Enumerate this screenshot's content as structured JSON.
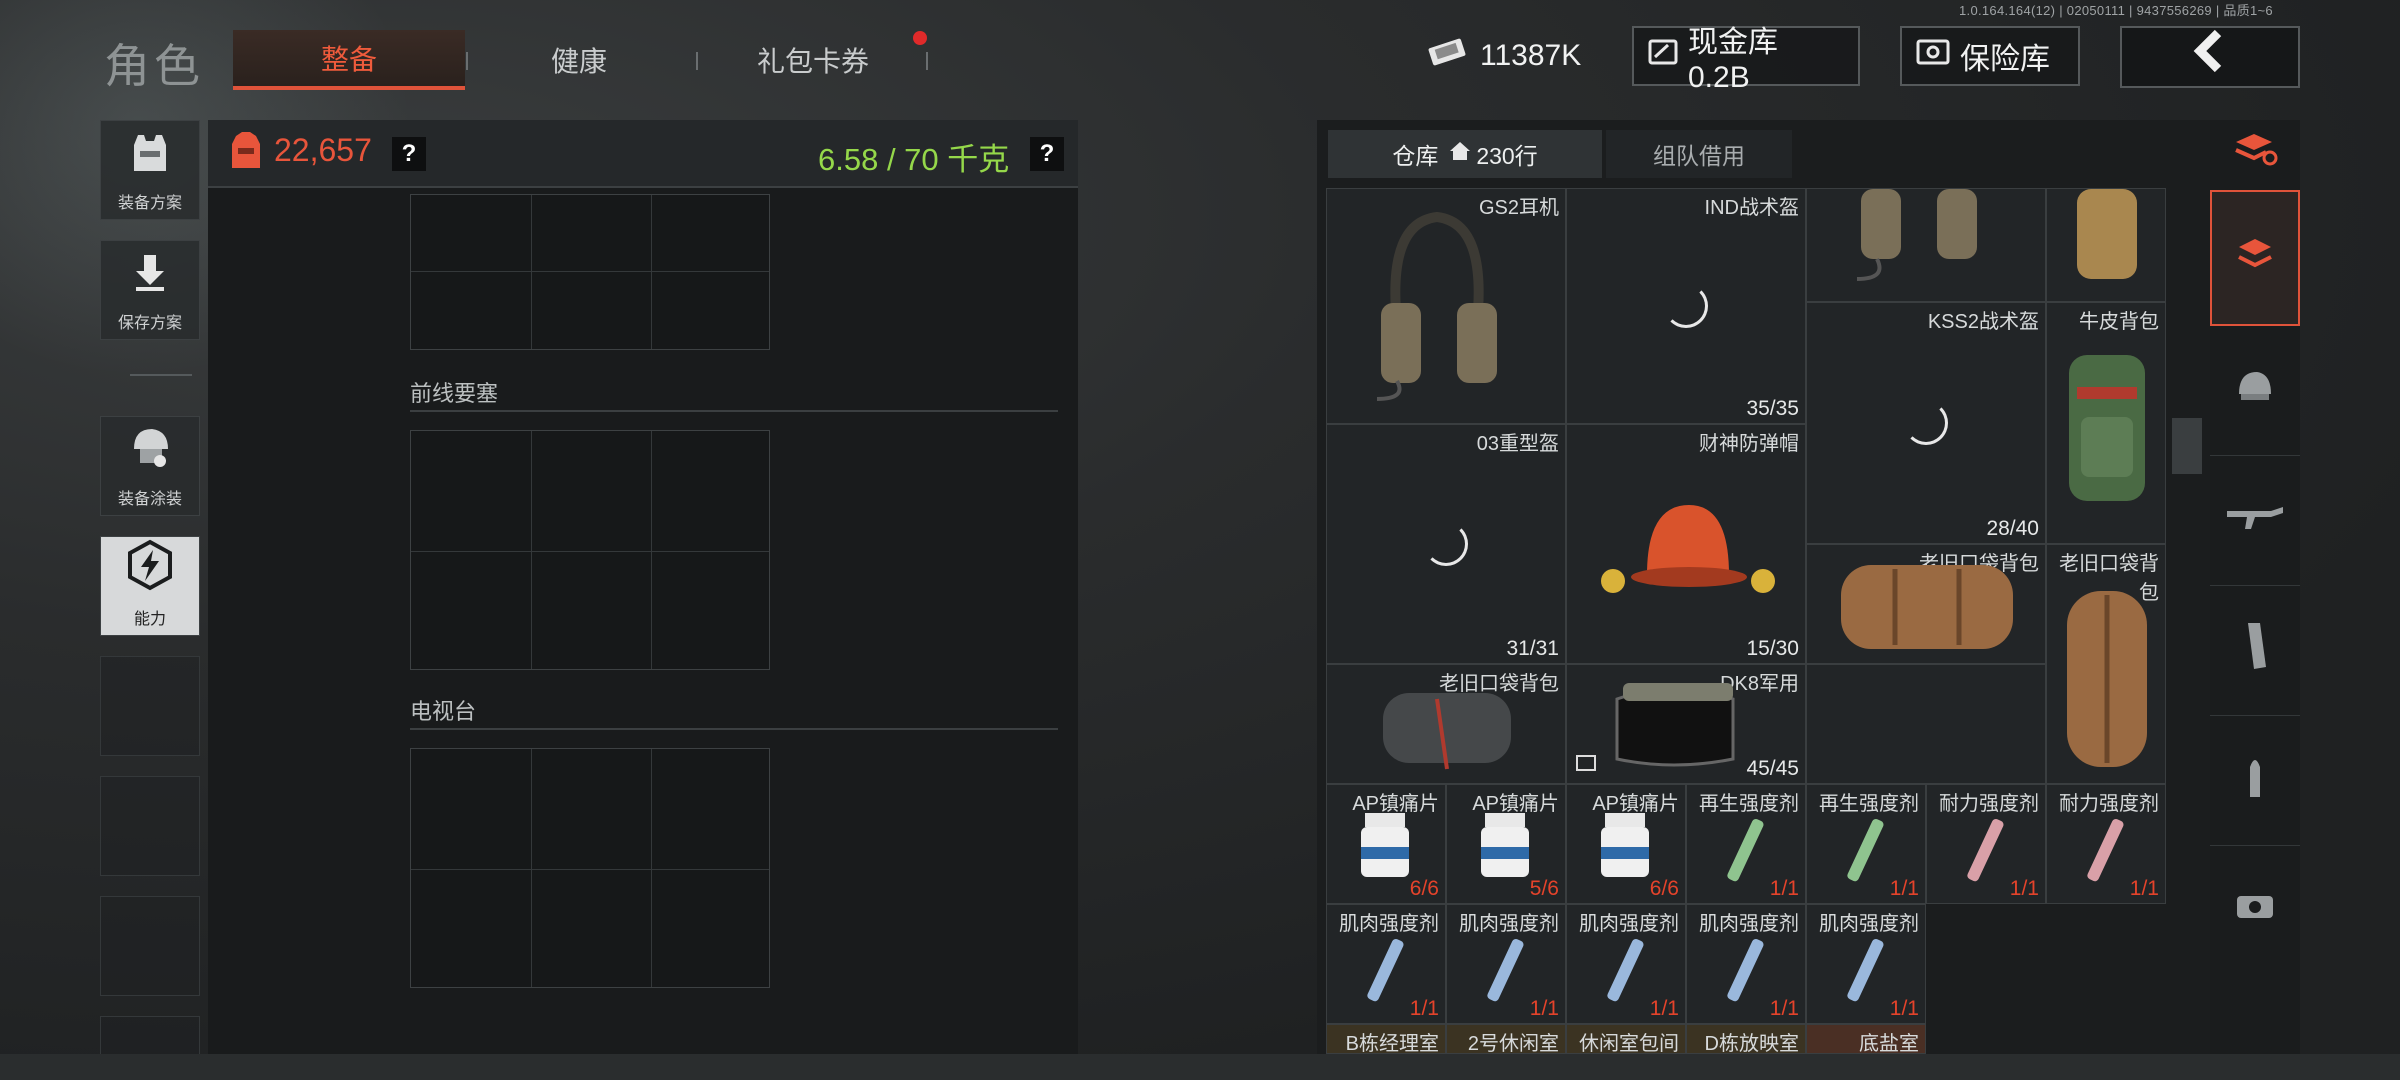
{
  "version": "1.0.164.164(12) | 02050111 | 9437556269 | 品质1~6",
  "header": {
    "title": "角色",
    "tabs": [
      {
        "label": "整备",
        "active": true
      },
      {
        "label": "健康",
        "active": false
      },
      {
        "label": "礼包卡券",
        "active": false,
        "notify": true
      }
    ],
    "money": "11387K",
    "cash_vault": "现金库 0.2B",
    "safe": "保险库",
    "back_icon": "chevron-left-icon"
  },
  "sidebar": {
    "buttons": [
      {
        "label": "装备方案",
        "icon": "vest-icon"
      },
      {
        "label": "保存方案",
        "icon": "download-icon"
      },
      {
        "label": "装备涂装",
        "icon": "helmet-paint-icon"
      },
      {
        "label": "能力",
        "icon": "ability-icon",
        "active": true
      }
    ]
  },
  "loadout": {
    "value": "22,657",
    "weight": "6.58 / 70 千克",
    "help": "?",
    "sections": [
      {
        "label": ""
      },
      {
        "label": "前线要塞"
      },
      {
        "label": "电视台"
      }
    ]
  },
  "warehouse": {
    "tabs": [
      {
        "label": "仓库",
        "rows": "230行",
        "active": true
      },
      {
        "label": "组队借用",
        "active": false
      }
    ],
    "items": [
      {
        "name": "GS2耳机",
        "count": ""
      },
      {
        "name": "IND战术盔",
        "count": "35/35"
      },
      {
        "name": "",
        "count": ""
      },
      {
        "name": "",
        "count": ""
      },
      {
        "name": "KSS2战术盔",
        "count": "28/40"
      },
      {
        "name": "牛皮背包",
        "count": ""
      },
      {
        "name": "03重型盔",
        "count": "31/31"
      },
      {
        "name": "财神防弹帽",
        "count": "15/30"
      },
      {
        "name": "老旧口袋背包",
        "count": ""
      },
      {
        "name": "老旧口袋背包",
        "count": ""
      },
      {
        "name": "老旧口袋背包",
        "count": ""
      },
      {
        "name": "DK8军用",
        "count": "45/45"
      },
      {
        "name": "AP镇痛片",
        "count": "6/6"
      },
      {
        "name": "AP镇痛片",
        "count": "5/6"
      },
      {
        "name": "AP镇痛片",
        "count": "6/6"
      },
      {
        "name": "再生强度剂",
        "count": "1/1"
      },
      {
        "name": "再生强度剂",
        "count": "1/1"
      },
      {
        "name": "耐力强度剂",
        "count": "1/1"
      },
      {
        "name": "耐力强度剂",
        "count": "1/1"
      },
      {
        "name": "肌肉强度剂",
        "count": "1/1"
      },
      {
        "name": "肌肉强度剂",
        "count": "1/1"
      },
      {
        "name": "肌肉强度剂",
        "count": "1/1"
      },
      {
        "name": "肌肉强度剂",
        "count": "1/1"
      },
      {
        "name": "肌肉强度剂",
        "count": "1/1"
      },
      {
        "name": "B栋经理室",
        "count": ""
      },
      {
        "name": "2号休闲室",
        "count": ""
      },
      {
        "name": "休闲室包间",
        "count": ""
      },
      {
        "name": "D栋放映室",
        "count": ""
      },
      {
        "name": "底盐室",
        "count": ""
      }
    ]
  },
  "rail": [
    {
      "icon": "stack-refresh-icon"
    },
    {
      "icon": "layers-icon",
      "selected": true
    },
    {
      "icon": "helmet-icon"
    },
    {
      "icon": "rifle-icon"
    },
    {
      "icon": "magazine-icon"
    },
    {
      "icon": "ammo-icon"
    },
    {
      "icon": "scope-icon"
    }
  ],
  "colors": {
    "accent": "#e8553b",
    "weight_ok": "#95d84a",
    "count_red": "#e4432b"
  }
}
